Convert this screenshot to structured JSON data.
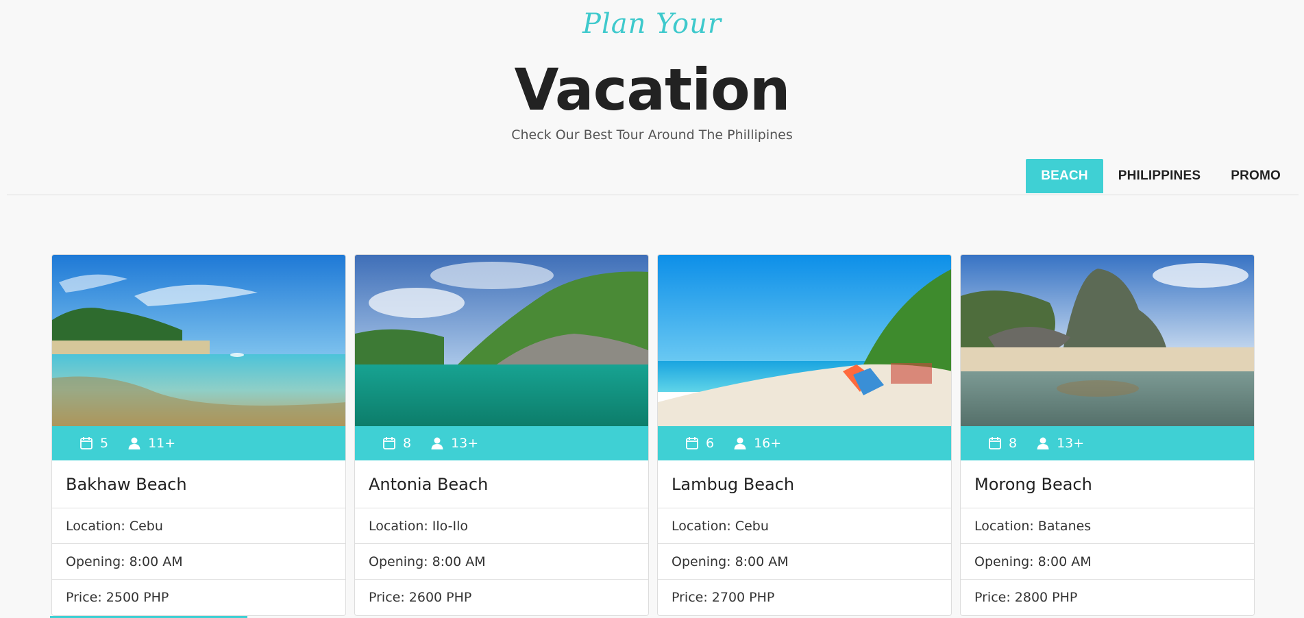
{
  "header": {
    "script_title": "Plan Your",
    "title": "Vacation",
    "subtitle": "Check Our Best Tour Around The Phillipines"
  },
  "filters": {
    "beach": "BEACH",
    "philippines": "PHILIPPINES",
    "promo": "PROMO",
    "active": "BEACH"
  },
  "colors": {
    "accent": "#3fd0d4",
    "script": "#3ec9cc"
  },
  "cards": [
    {
      "title": "Bakhaw Beach",
      "days": "5",
      "people": "11+",
      "location": "Location: Cebu",
      "opening": "Opening: 8:00 AM",
      "price": "Price: 2500 PHP"
    },
    {
      "title": "Antonia Beach",
      "days": "8",
      "people": "13+",
      "location": "Location: Ilo-Ilo",
      "opening": "Opening: 8:00 AM",
      "price": "Price: 2600 PHP"
    },
    {
      "title": "Lambug Beach",
      "days": "6",
      "people": "16+",
      "location": "Location: Cebu",
      "opening": "Opening: 8:00 AM",
      "price": "Price: 2700 PHP"
    },
    {
      "title": "Morong Beach",
      "days": "8",
      "people": "13+",
      "location": "Location: Batanes",
      "opening": "Opening: 8:00 AM",
      "price": "Price: 2800 PHP"
    }
  ],
  "icons": {
    "days": "calendar-icon",
    "people": "person-icon"
  }
}
